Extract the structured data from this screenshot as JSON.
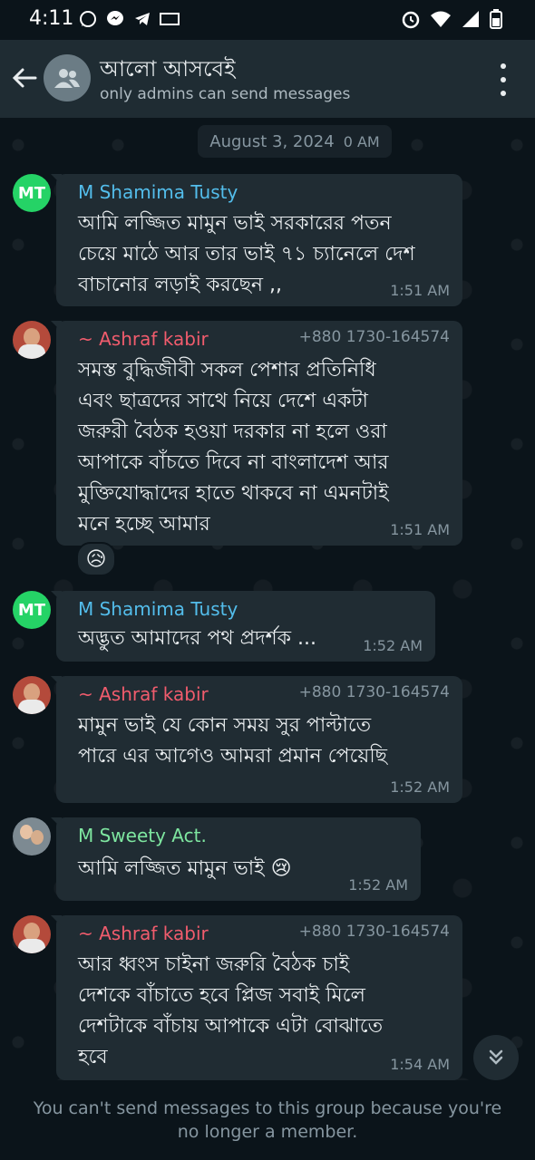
{
  "status_bar": {
    "time": "4:11"
  },
  "header": {
    "title": "আলো আসবেই",
    "subtitle": "only admins can send messages"
  },
  "chat": {
    "date_separator": "August 3, 2024",
    "date_cut_time": "0 AM",
    "messages": [
      {
        "sender": "M Shamima Tusty",
        "avatar_text": "MT",
        "sender_color": "#53bdeb",
        "text": "আমি লজ্জিত মামুন ভাই সরকারের পতন\nচেয়ে মাঠে আর তার ভাই ৭১ চ্যানেলে দেশ\nবাচানোর লড়াই করছেন ,,",
        "time": "1:51 AM"
      },
      {
        "sender": "~ Ashraf kabir",
        "phone": "+880 1730-164574",
        "sender_color": "#f15c6d",
        "text": "সমস্ত বুদ্ধিজীবী সকল পেশার প্রতিনিধি\nএবং ছাত্রদের সাথে নিয়ে দেশে একটা\nজরুরী বৈঠক হওয়া দরকার না হলে ওরা\nআপাকে বাঁচতে দিবে না বাংলাদেশ আর\nমুক্তিযোদ্ধাদের হাতে থাকবে না এমনটাই\nমনে হচ্ছে আমার",
        "time": "1:51 AM",
        "reaction": "😥"
      },
      {
        "sender": "M Shamima Tusty",
        "avatar_text": "MT",
        "sender_color": "#53bdeb",
        "text": "অদ্ভুত আমাদের পথ প্রদর্শক ...",
        "time": "1:52 AM"
      },
      {
        "sender": "~ Ashraf kabir",
        "phone": "+880 1730-164574",
        "sender_color": "#f15c6d",
        "text": "মামুন ভাই যে কোন সময় সুর পাল্টাতে\nপারে এর আগেও আমরা প্রমান পেয়েছি",
        "time": "1:52 AM"
      },
      {
        "sender": "M Sweety Act.",
        "sender_color": "#7ee6a0",
        "text": "আমি লজ্জিত মামুন ভাই 😢",
        "time": "1:52 AM"
      },
      {
        "sender": "~ Ashraf kabir",
        "phone": "+880 1730-164574",
        "sender_color": "#f15c6d",
        "text": "আর ধ্বংস চাইনা জরুরি বৈঠক চাই\nদেশকে বাঁচাতে হবে প্লিজ সবাই মিলে\nদেশটাকে বাঁচায় আপাকে এটা বোঝাতে\nহবে",
        "time": "1:54 AM"
      }
    ]
  },
  "footer": {
    "text": "You can't send messages to this group because you're no longer a member."
  }
}
